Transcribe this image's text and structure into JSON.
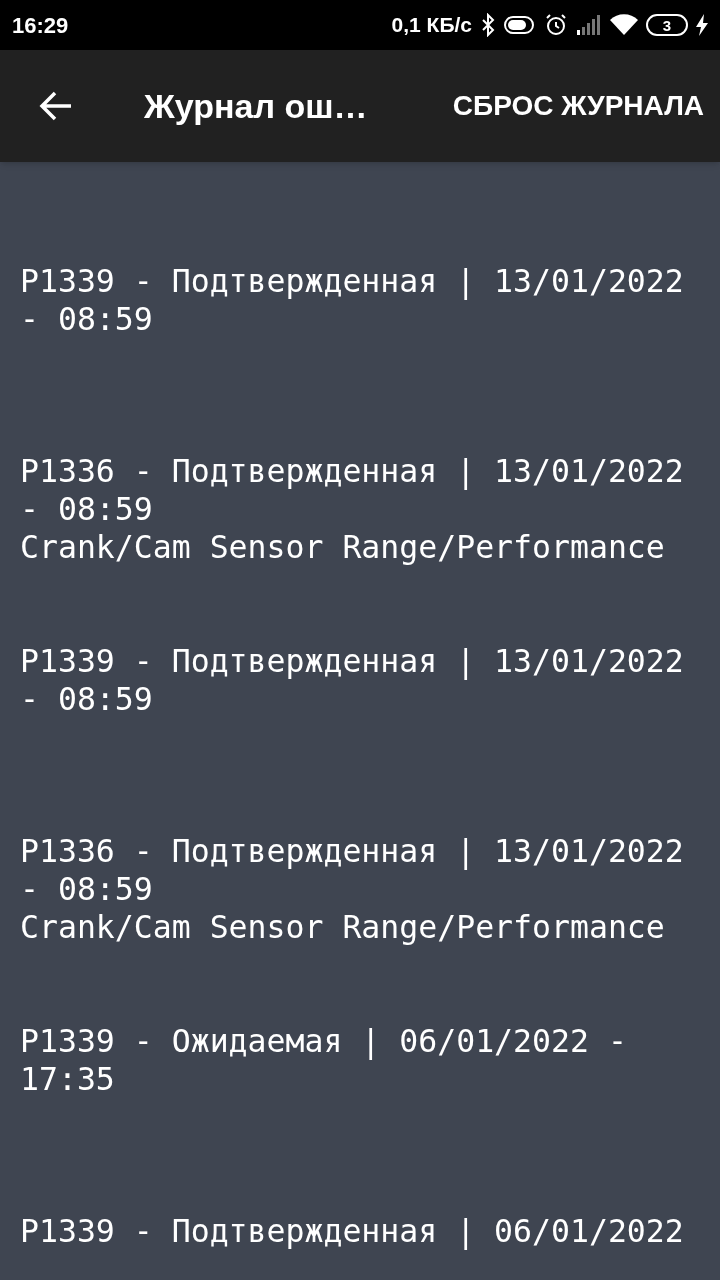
{
  "status_bar": {
    "time": "16:29",
    "network_speed": "0,1 КБ/с",
    "battery": "3"
  },
  "app_bar": {
    "title": "Журнал ош…",
    "action": "СБРОС ЖУРНАЛА"
  },
  "entries": [
    {
      "line": "P1339 - Подтвержденная | 13/01/2022 - 08:59"
    },
    {
      "line": "P1336 - Подтвержденная | 13/01/2022 - 08:59",
      "description": "Crank/Cam Sensor Range/Performance"
    },
    {
      "line": "P1339 - Подтвержденная | 13/01/2022 - 08:59"
    },
    {
      "line": "P1336 - Подтвержденная | 13/01/2022 - 08:59",
      "description": "Crank/Cam Sensor Range/Performance"
    },
    {
      "line": "P1339 - Ожидаемая | 06/01/2022 - 17:35"
    },
    {
      "line": "P1339 - Подтвержденная | 06/01/2022"
    }
  ]
}
